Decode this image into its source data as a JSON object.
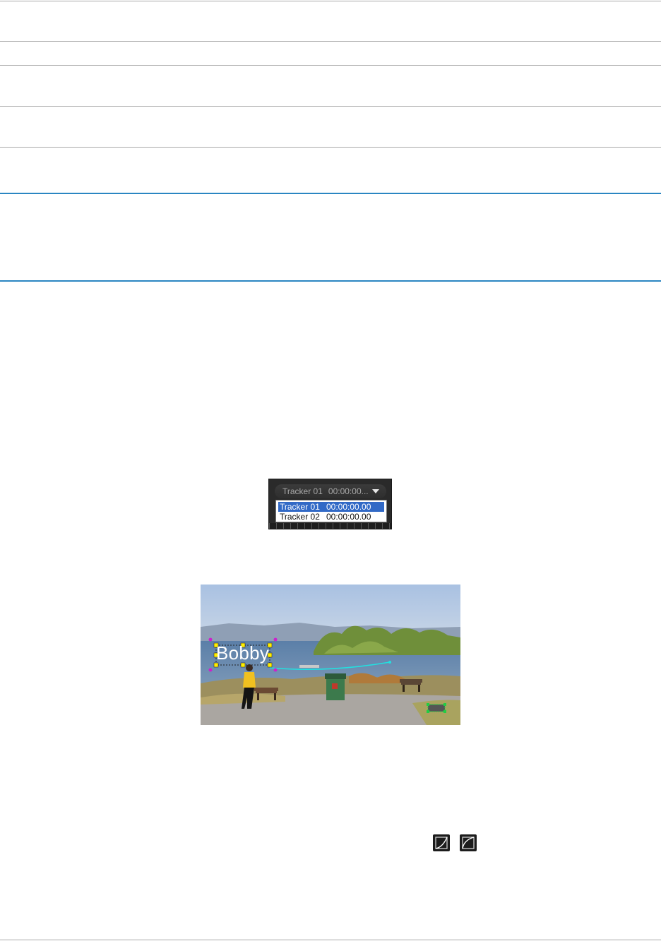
{
  "tracker_widget": {
    "combo_label": "Tracker 01",
    "combo_time": "00:00:00...",
    "items": [
      {
        "name": "Tracker 01",
        "time": "00:00:00.00",
        "selected": true
      },
      {
        "name": "Tracker 02",
        "time": "00:00:00.00",
        "selected": false
      }
    ],
    "selected_color": "#3169c6"
  },
  "scene": {
    "text_object": "Bobby",
    "path_color": "#22e0e0",
    "handle_color": "#ffee00",
    "rotate_handle_color": "#cc22cc"
  },
  "icons": [
    "curve-graph-icon",
    "curve-graph-alt-icon"
  ],
  "colors": {
    "rule_gray": "#a8a8a8",
    "rule_blue": "#2a86c2"
  }
}
